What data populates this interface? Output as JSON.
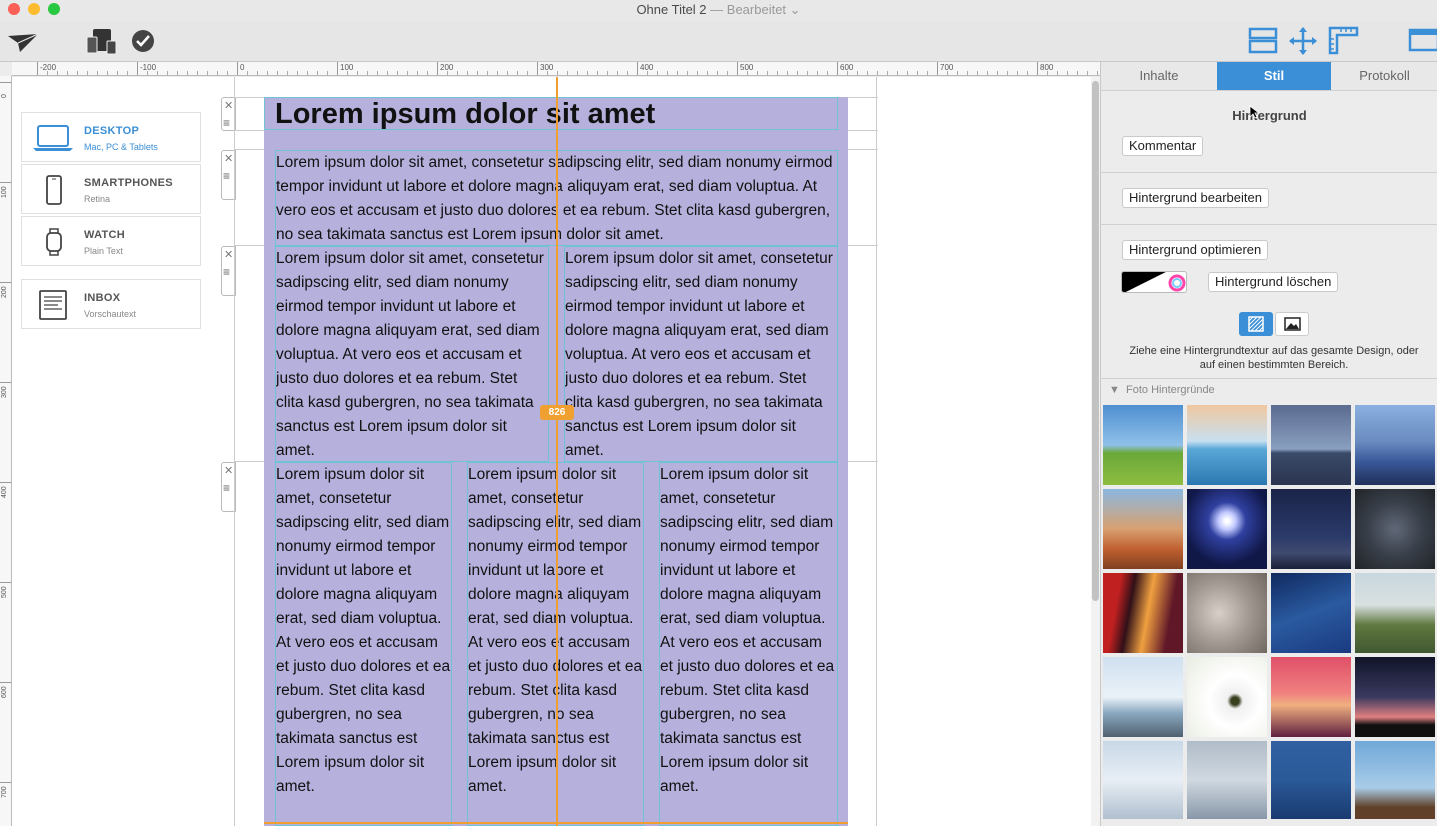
{
  "window": {
    "title": "Ohne Titel 2",
    "status": "— Bearbeitet ⌄"
  },
  "ruler": {
    "h_labels": [
      "-200",
      "-100",
      "0",
      "100",
      "200",
      "300",
      "400",
      "500",
      "600",
      "700",
      "800"
    ],
    "v_labels": [
      "0",
      "100",
      "200",
      "300",
      "400",
      "500",
      "600",
      "700"
    ]
  },
  "devices": [
    {
      "name": "DESKTOP",
      "sub": "Mac, PC & Tablets",
      "icon": "laptop-icon"
    },
    {
      "name": "SMARTPHONES",
      "sub": "Retina",
      "icon": "smartphone-icon"
    },
    {
      "name": "WATCH",
      "sub": "Plain Text",
      "icon": "watch-icon"
    },
    {
      "name": "INBOX",
      "sub": "Vorschautext",
      "icon": "inbox-icon"
    }
  ],
  "design": {
    "headline": "Lorem ipsum dolor sit amet",
    "para_full": "Lorem ipsum dolor sit amet, consetetur sadipscing elitr, sed diam nonumy eirmod tempor invidunt ut labore et dolore magna aliquyam erat, sed diam voluptua. At vero eos et accusam et justo duo dolores et ea rebum. Stet clita kasd gubergren, no sea takimata sanctus est Lorem ipsum dolor sit amet.",
    "para_col": "Lorem ipsum dolor sit amet, consetetur sadipscing elitr, sed diam nonumy eirmod tempor invidunt ut labore et dolore magna aliquyam erat, sed diam voluptua. At vero eos et accusam et justo duo dolores et ea rebum. Stet clita kasd gubergren, no sea takimata sanctus est Lorem ipsum dolor sit amet.",
    "guide_badge": "826"
  },
  "panel": {
    "tabs": [
      "Inhalte",
      "Stil",
      "Protokoll"
    ],
    "section_title": "Hintergrund",
    "btn_comment": "Kommentar",
    "btn_edit": "Hintergrund bearbeiten",
    "btn_optimize": "Hintergrund optimieren",
    "btn_delete": "Hintergrund löschen",
    "hint": "Ziehe eine Hintergrundtextur auf das gesamte Design, oder auf einen bestimmten Bereich.",
    "photo_section": "Foto Hintergründe"
  },
  "colors": {
    "accent": "#3a8fd6",
    "guide": "#f0a030",
    "design_bg": "#b6b0dc"
  }
}
